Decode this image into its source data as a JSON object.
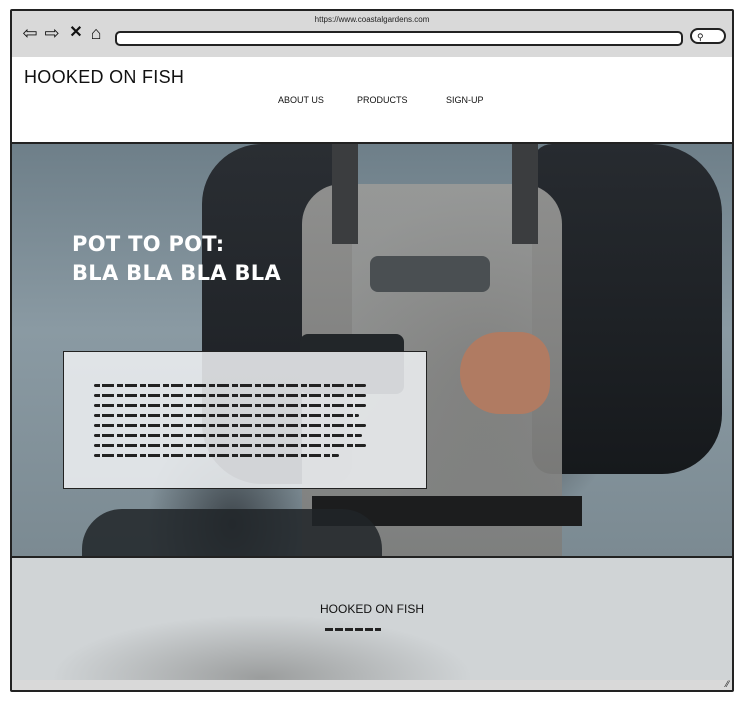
{
  "browser": {
    "url": "https://www.coastalgardens.com",
    "nav_icons": [
      "back-arrow-icon",
      "forward-arrow-icon",
      "close-icon",
      "home-icon"
    ]
  },
  "header": {
    "logo": "HOOKED ON FISH",
    "menu": [
      "ABOUT US",
      "PRODUCTS",
      "SIGN-UP"
    ]
  },
  "hero": {
    "title_line1": "POT TO POT:",
    "title_line2": "BLA BLA BLA BLA",
    "card_placeholder_lines": 8
  },
  "footer": {
    "title": "HOOKED ON FISH"
  },
  "colors": {
    "chrome": "#d9d9d9",
    "outline": "#222222",
    "hero_text": "#ffffff"
  }
}
